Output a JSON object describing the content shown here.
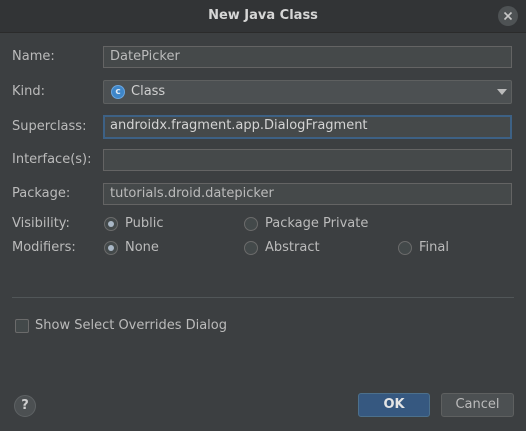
{
  "window": {
    "title": "New Java Class"
  },
  "form": {
    "name": {
      "label": "Name:",
      "value": "DatePicker"
    },
    "kind": {
      "label": "Kind:",
      "value": "Class",
      "icon": "class-c-icon",
      "icon_glyph": "c"
    },
    "superclass": {
      "label": "Superclass:",
      "value": "androidx.fragment.app.DialogFragment"
    },
    "interfaces": {
      "label": "Interface(s):",
      "value": ""
    },
    "package": {
      "label": "Package:",
      "value": "tutorials.droid.datepicker"
    },
    "visibility": {
      "label": "Visibility:",
      "options": [
        {
          "label": "Public",
          "selected": true
        },
        {
          "label": "Package Private",
          "selected": false
        }
      ]
    },
    "modifiers": {
      "label": "Modifiers:",
      "options": [
        {
          "label": "None",
          "selected": true
        },
        {
          "label": "Abstract",
          "selected": false
        },
        {
          "label": "Final",
          "selected": false
        }
      ]
    },
    "show_overrides": {
      "label": "Show Select Overrides Dialog",
      "checked": false
    }
  },
  "footer": {
    "help": "?",
    "ok": "OK",
    "cancel": "Cancel"
  },
  "colors": {
    "background": "#3c3f41",
    "accent": "#365880",
    "focus_border": "#3d6185"
  }
}
